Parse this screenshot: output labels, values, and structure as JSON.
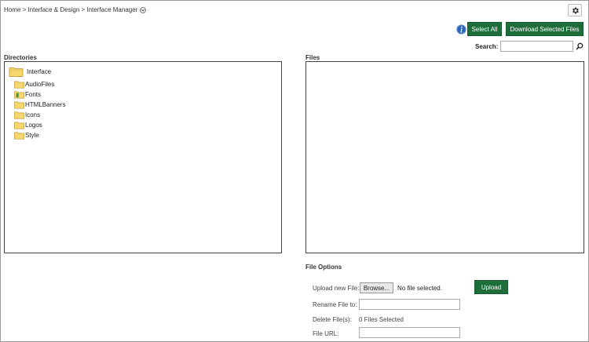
{
  "breadcrumb": {
    "text": "Home > Interface & Design > Interface Manager"
  },
  "toolbar": {
    "select_all_label": "Select All",
    "download_label": "Download Selected Files"
  },
  "search": {
    "label": "Search:",
    "value": "",
    "placeholder": ""
  },
  "directories": {
    "title": "Directories",
    "root": "Interface",
    "items": [
      {
        "label": "AudioFiles"
      },
      {
        "label": "Fonts"
      },
      {
        "label": "HTMLBanners"
      },
      {
        "label": "Icons"
      },
      {
        "label": "Logos"
      },
      {
        "label": "Style"
      }
    ]
  },
  "files": {
    "title": "Files"
  },
  "file_options": {
    "title": "File Options",
    "upload_label": "Upload new File:",
    "browse_label": "Browse...",
    "no_file_text": "No file selected.",
    "upload_button": "Upload",
    "rename_label": "Rename File to:",
    "rename_value": "",
    "delete_label": "Delete File(s):",
    "files_selected": "0 Files Selected",
    "url_label": "File URL:",
    "url_value": ""
  },
  "colors": {
    "button_green": "#1e6e3c",
    "folder_yellow": "#f5d76e",
    "info_blue": "#2a64b8"
  },
  "icons": {
    "gear": "gear-icon",
    "info": "info-icon",
    "search": "search-icon",
    "folder": "folder-icon",
    "dropdown": "chevron-down-icon"
  }
}
